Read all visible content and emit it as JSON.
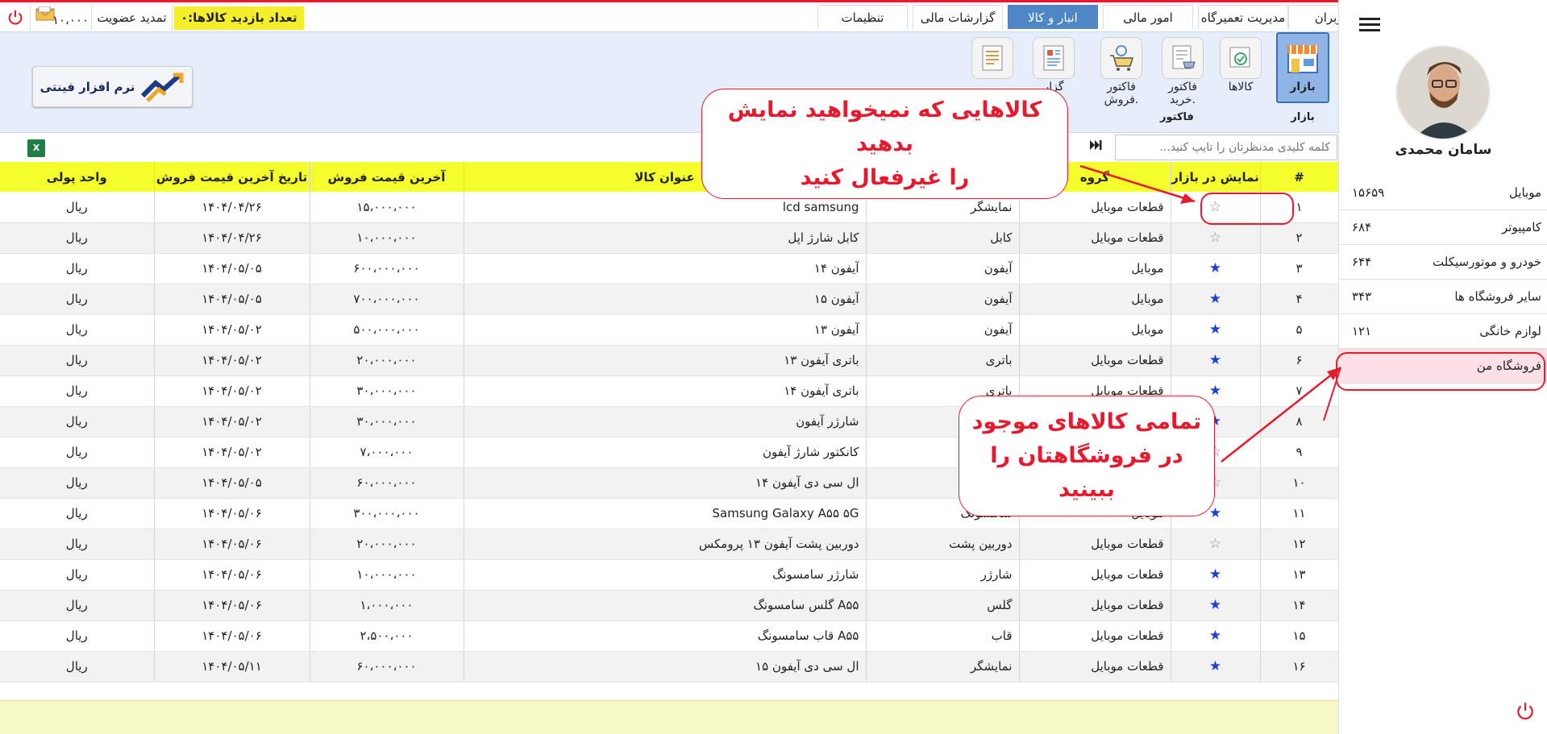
{
  "topbar": {
    "tabs": [
      "کاربران",
      "مدیریت تعمیرگاه",
      "امور مالی",
      "انبار و کالا",
      "گزارشات مالی",
      "تنظیمات"
    ],
    "active_tab_index": 3,
    "balance": "۱۰،۰۰۰",
    "renew_label": "تمدید عضویت",
    "visits_label": "تعداد بازدید کالاها:۰"
  },
  "ribbon": {
    "buttons": [
      "بازار",
      "کالاها",
      "فاکتور خرید.",
      "فاکتور فروش.",
      "گزار",
      ""
    ],
    "groups": [
      "بازار",
      "فاکتور"
    ]
  },
  "logo": {
    "text": "نرم افزار فینتی"
  },
  "excel": {
    "label": "X"
  },
  "search": {
    "placeholder": "کلمه کلیدی مدنظرتان را تایپ کنید..."
  },
  "table": {
    "headers": [
      "#",
      "نمایش در بازار",
      "گروه",
      "",
      "عنوان کالا",
      "آخرین قیمت فروش",
      "تاریخ آخرین قیمت فروش",
      "واحد پولی"
    ],
    "rows": [
      {
        "n": "۱",
        "star": false,
        "group": "قطعات موبایل",
        "sub": "نمایشگر",
        "title": "lcd samsung",
        "price": "۱۵،۰۰۰،۰۰۰",
        "date": "۱۴۰۴/۰۴/۲۶",
        "cur": "ریال"
      },
      {
        "n": "۲",
        "star": false,
        "group": "قطعات موبایل",
        "sub": "کابل",
        "title": "کابل شارژ اپل",
        "price": "۱۰،۰۰۰،۰۰۰",
        "date": "۱۴۰۴/۰۴/۲۶",
        "cur": "ریال"
      },
      {
        "n": "۳",
        "star": true,
        "group": "موبایل",
        "sub": "آیفون",
        "title": "آیفون ۱۴",
        "price": "۶۰۰،۰۰۰،۰۰۰",
        "date": "۱۴۰۴/۰۵/۰۵",
        "cur": "ریال"
      },
      {
        "n": "۴",
        "star": true,
        "group": "موبایل",
        "sub": "آیفون",
        "title": "آیفون ۱۵",
        "price": "۷۰۰،۰۰۰،۰۰۰",
        "date": "۱۴۰۴/۰۵/۰۵",
        "cur": "ریال"
      },
      {
        "n": "۵",
        "star": true,
        "group": "موبایل",
        "sub": "آیفون",
        "title": "آیفون ۱۳",
        "price": "۵۰۰،۰۰۰،۰۰۰",
        "date": "۱۴۰۴/۰۵/۰۲",
        "cur": "ریال"
      },
      {
        "n": "۶",
        "star": true,
        "group": "قطعات موبایل",
        "sub": "باتری",
        "title": "باتری آیفون ۱۳",
        "price": "۲۰،۰۰۰،۰۰۰",
        "date": "۱۴۰۴/۰۵/۰۲",
        "cur": "ریال"
      },
      {
        "n": "۷",
        "star": true,
        "group": "قطعات موبایل",
        "sub": "باتری",
        "title": "باتری آیفون ۱۴",
        "price": "۳۰،۰۰۰،۰۰۰",
        "date": "۱۴۰۴/۰۵/۰۲",
        "cur": "ریال"
      },
      {
        "n": "۸",
        "star": true,
        "group": "",
        "sub": "",
        "title": "شارژر آیفون",
        "price": "۳۰،۰۰۰،۰۰۰",
        "date": "۱۴۰۴/۰۵/۰۲",
        "cur": "ریال"
      },
      {
        "n": "۹",
        "star": false,
        "group": "",
        "sub": "ژر",
        "title": "کانکتور شارژ آیفون",
        "price": "۷،۰۰۰،۰۰۰",
        "date": "۱۴۰۴/۰۵/۰۲",
        "cur": "ریال"
      },
      {
        "n": "۱۰",
        "star": false,
        "group": "",
        "sub": "",
        "title": "ال سی دی آیفون ۱۴",
        "price": "۶۰،۰۰۰،۰۰۰",
        "date": "۱۴۰۴/۰۵/۰۵",
        "cur": "ریال"
      },
      {
        "n": "۱۱",
        "star": true,
        "group": "موبایل",
        "sub": "سامسونگ",
        "title": "Samsung Galaxy A۵۵ ۵G",
        "price": "۳۰۰،۰۰۰،۰۰۰",
        "date": "۱۴۰۴/۰۵/۰۶",
        "cur": "ریال"
      },
      {
        "n": "۱۲",
        "star": false,
        "group": "قطعات موبایل",
        "sub": "دوربین پشت",
        "title": "دوربین پشت آیفون ۱۳ پرومکس",
        "price": "۲۰،۰۰۰،۰۰۰",
        "date": "۱۴۰۴/۰۵/۰۶",
        "cur": "ریال"
      },
      {
        "n": "۱۳",
        "star": true,
        "group": "قطعات موبایل",
        "sub": "شارژر",
        "title": "شارژر سامسونگ",
        "price": "۱۰،۰۰۰،۰۰۰",
        "date": "۱۴۰۴/۰۵/۰۶",
        "cur": "ریال"
      },
      {
        "n": "۱۴",
        "star": true,
        "group": "قطعات موبایل",
        "sub": "گلس",
        "title": "گلس سامسونگ A۵۵",
        "price": "۱،۰۰۰،۰۰۰",
        "date": "۱۴۰۴/۰۵/۰۶",
        "cur": "ریال"
      },
      {
        "n": "۱۵",
        "star": true,
        "group": "قطعات موبایل",
        "sub": "قاب",
        "title": "قاب سامسونگ A۵۵",
        "price": "۲،۵۰۰،۰۰۰",
        "date": "۱۴۰۴/۰۵/۰۶",
        "cur": "ریال"
      },
      {
        "n": "۱۶",
        "star": true,
        "group": "قطعات موبایل",
        "sub": "نمایشگر",
        "title": "ال سی دی آیفون ۱۵",
        "price": "۶۰،۰۰۰،۰۰۰",
        "date": "۱۴۰۴/۰۵/۱۱",
        "cur": "ریال"
      }
    ]
  },
  "callouts": {
    "top": [
      "کالاهایی که نمیخواهید نمایش بدهید",
      "را غیرفعال کنید"
    ],
    "bottom": [
      "تمامی کالاهای موجود",
      "در فروشگاهتان را ببینید"
    ]
  },
  "sidebar": {
    "user_name": "سامان محمدی",
    "categories": [
      {
        "name": "موبایل",
        "count": "۱۵۶۵۹"
      },
      {
        "name": "کامپیوتر",
        "count": "۶۸۴"
      },
      {
        "name": "خودرو و موتورسیکلت",
        "count": "۶۴۴"
      },
      {
        "name": "سایر فروشگاه ها",
        "count": "۳۴۳"
      },
      {
        "name": "لوازم خانگی",
        "count": "۱۲۱"
      },
      {
        "name": "فروشگاه من",
        "count": ""
      }
    ]
  },
  "colors": {
    "accent": "#e8192c",
    "header_yellow": "#f5ff2b",
    "active_tab": "#4f86c6",
    "star_on": "#1d3fd6",
    "ribbon_bg": "#e7eefb"
  }
}
